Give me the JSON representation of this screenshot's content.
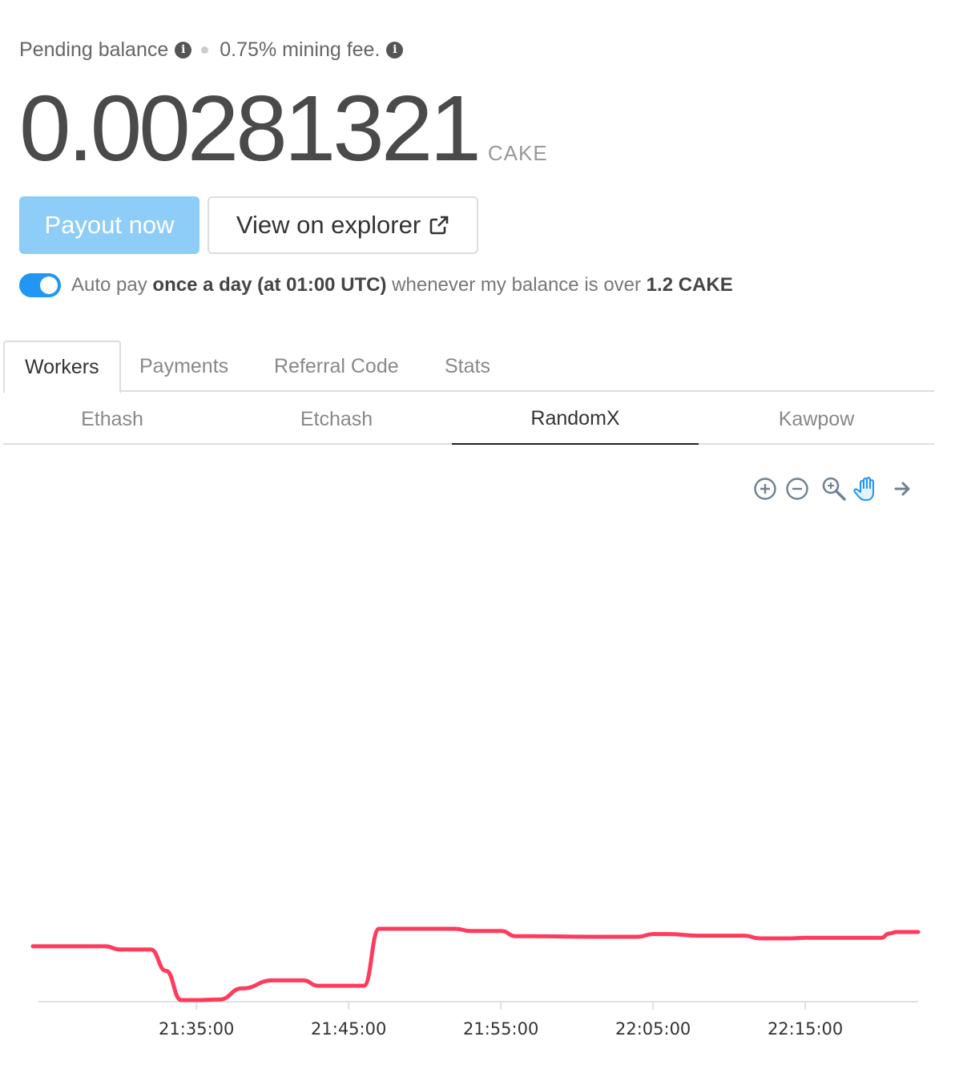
{
  "pending": {
    "label": "Pending balance",
    "fee_text": "0.75% mining fee."
  },
  "balance": {
    "value": "0.00281321",
    "unit": "CAKE"
  },
  "buttons": {
    "payout": "Payout now",
    "explorer": "View on explorer"
  },
  "autopay": {
    "enabled": true,
    "prefix": "Auto pay ",
    "frequency": "once a day",
    "time": " (at 01:00 UTC)",
    "middle": " whenever my balance is over ",
    "threshold": "1.2 CAKE"
  },
  "tabs": [
    "Workers",
    "Payments",
    "Referral Code",
    "Stats"
  ],
  "active_tab": "Workers",
  "algorithms": [
    "Ethash",
    "Etchash",
    "RandomX",
    "Kawpow"
  ],
  "active_algorithm": "RandomX",
  "toolbar": {
    "icons": [
      "zoom-in-icon",
      "zoom-out-icon",
      "magnifier-icon",
      "pan-hand-icon",
      "reset-arrow-icon"
    ],
    "active_icon": "pan-hand-icon"
  },
  "colors": {
    "accent": "#2196f3",
    "payout_button": "#8ecdf7",
    "series": "#ff3b5c"
  },
  "chart_data": {
    "type": "line",
    "x_unit": "time",
    "x_tick_labels": [
      "21:35:00",
      "21:45:00",
      "21:55:00",
      "22:05:00",
      "22:15:00"
    ],
    "xlim": [
      "21:24:15",
      "22:22:25"
    ],
    "y_axis_shown": false,
    "grid": false,
    "legend": "none",
    "x": [
      "21:24:15",
      "21:29:00",
      "21:30:00",
      "21:32:00",
      "21:33:00",
      "21:34:00",
      "21:35:00",
      "21:36:30",
      "21:38:00",
      "21:40:00",
      "21:42:00",
      "21:43:00",
      "21:44:00",
      "21:45:00",
      "21:46:00",
      "21:47:00",
      "21:47:30",
      "21:48:00",
      "21:52:00",
      "21:53:00",
      "21:55:00",
      "21:56:00",
      "21:57:00",
      "22:01:00",
      "22:02:00",
      "22:04:00",
      "22:05:00",
      "22:06:00",
      "22:08:00",
      "22:09:00",
      "22:11:00",
      "22:12:00",
      "22:14:00",
      "22:15:00",
      "22:18:00",
      "22:19:00",
      "22:20:00",
      "22:20:30",
      "22:21:00",
      "22:22:25"
    ],
    "y": [
      45.6,
      45.6,
      45.0,
      45.0,
      41.0,
      35.5,
      35.5,
      35.6,
      37.7,
      39.2,
      39.2,
      38.2,
      38.2,
      38.2,
      38.2,
      48.9,
      48.9,
      48.9,
      48.9,
      48.5,
      48.5,
      47.5,
      47.5,
      47.4,
      47.4,
      47.4,
      47.9,
      47.9,
      47.6,
      47.6,
      47.6,
      47.1,
      47.1,
      47.2,
      47.2,
      47.2,
      47.2,
      48.0,
      48.3,
      48.3
    ]
  }
}
